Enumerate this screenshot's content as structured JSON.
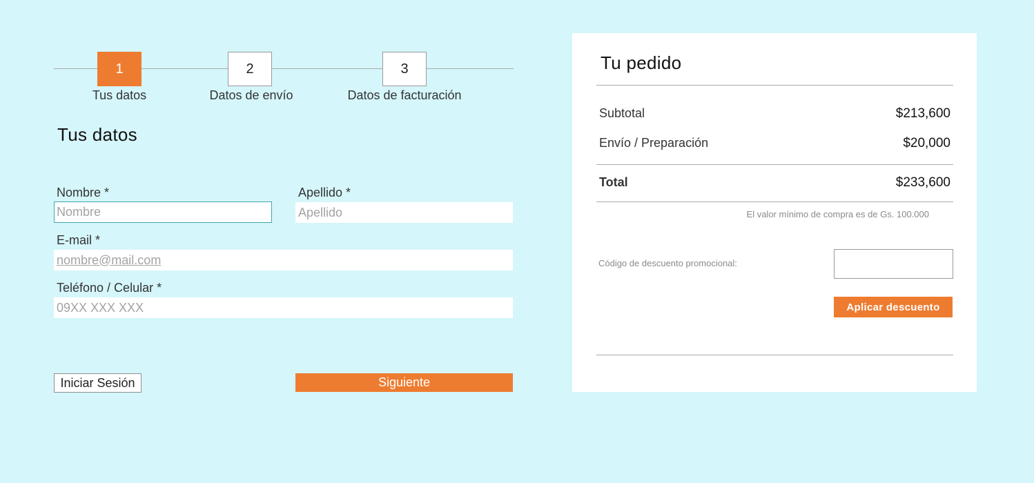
{
  "stepper": {
    "steps": [
      {
        "number": "1",
        "label": "Tus datos",
        "active": true
      },
      {
        "number": "2",
        "label": "Datos de envío",
        "active": false
      },
      {
        "number": "3",
        "label": "Datos de facturación",
        "active": false
      }
    ]
  },
  "form": {
    "title": "Tus datos",
    "nombre": {
      "label": "Nombre *",
      "placeholder": "Nombre",
      "value": ""
    },
    "apellido": {
      "label": "Apellido *",
      "placeholder": "Apellido",
      "value": ""
    },
    "email": {
      "label": "E-mail *",
      "placeholder": "nombre@mail.com",
      "value": ""
    },
    "telefono": {
      "label": "Teléfono / Celular *",
      "placeholder": "09XX XXX XXX",
      "value": ""
    },
    "login_button": "Iniciar Sesión",
    "next_button": "Siguiente"
  },
  "order": {
    "title": "Tu pedido",
    "subtotal_label": "Subtotal",
    "subtotal_value": "$213,600",
    "shipping_label": "Envío / Preparación",
    "shipping_value": "$20,000",
    "total_label": "Total",
    "total_value": "$233,600",
    "min_purchase_note": "El valor mínimo de compra es de Gs. 100.000",
    "promo_label": "Código de descuento promocional:",
    "promo_value": "",
    "apply_button": "Aplicar descuento"
  },
  "colors": {
    "background": "#d5f6fb",
    "accent": "#ee7c30",
    "focus_border": "#3fa6b0"
  }
}
